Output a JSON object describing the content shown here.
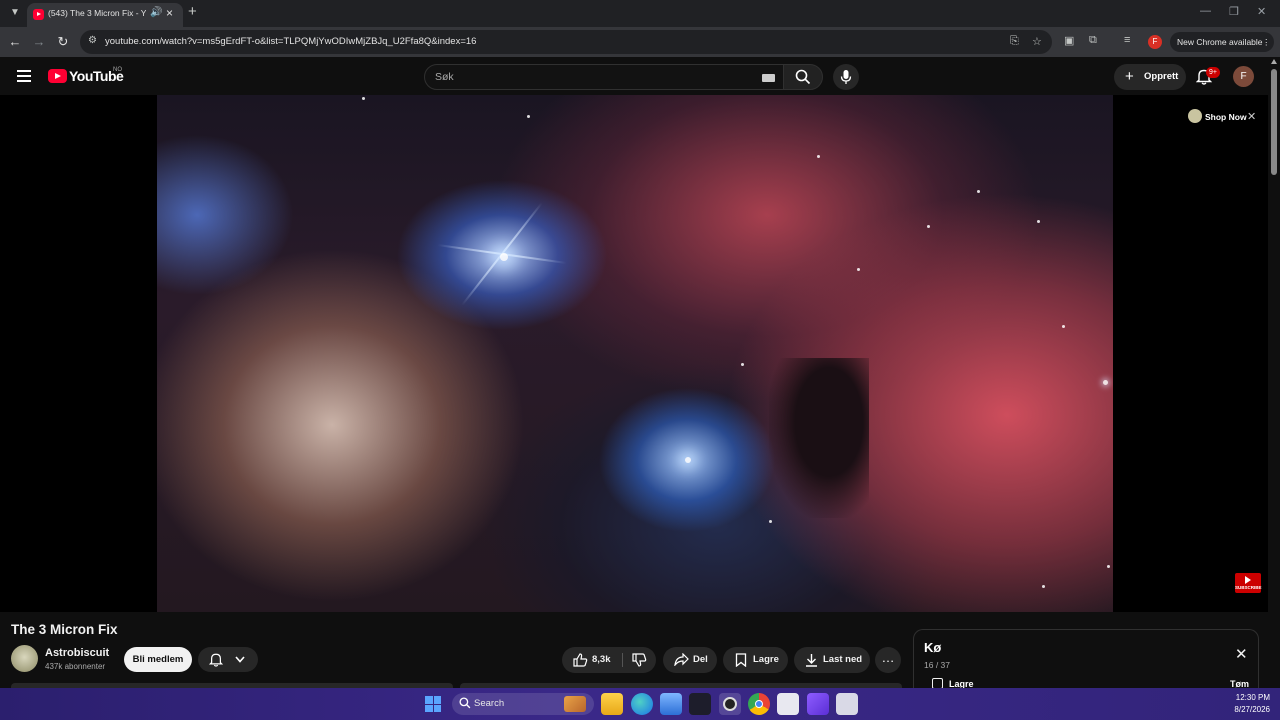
{
  "browser": {
    "tab_title": "(543) The 3 Micron Fix - YouTube",
    "url": "youtube.com/watch?v=ms5gErdFT-o&list=TLPQMjYwODIwMjZBJq_U2Ffa8Q&index=16",
    "profile_initial": "F",
    "update_label": "New Chrome available"
  },
  "youtube": {
    "logo_text": "YouTube",
    "country_code": "NO",
    "search_placeholder": "Søk",
    "create_label": "Opprett",
    "notifications_badge": "9+",
    "avatar_initial": "F"
  },
  "player": {
    "ad_label": "Shop Now",
    "watermark_text": "SUBSCRIBE"
  },
  "video": {
    "title": "The 3 Micron Fix",
    "channel_name": "Astrobiscuit",
    "subscribers": "437k abonnenter",
    "join_label": "Bli medlem",
    "likes": "8,3k",
    "share_label": "Del",
    "save_label": "Lagre",
    "download_label": "Last ned"
  },
  "queue": {
    "title": "Kø",
    "position": "16 / 37",
    "save_label": "Lagre",
    "clear_label": "Tøm"
  },
  "taskbar": {
    "search_label": "Search",
    "time": "12:30 PM",
    "date": "8/27/2026"
  },
  "colors": {
    "youtube_red": "#ff0033",
    "taskbar": "#3a2888",
    "background": "#0f0f0f"
  }
}
